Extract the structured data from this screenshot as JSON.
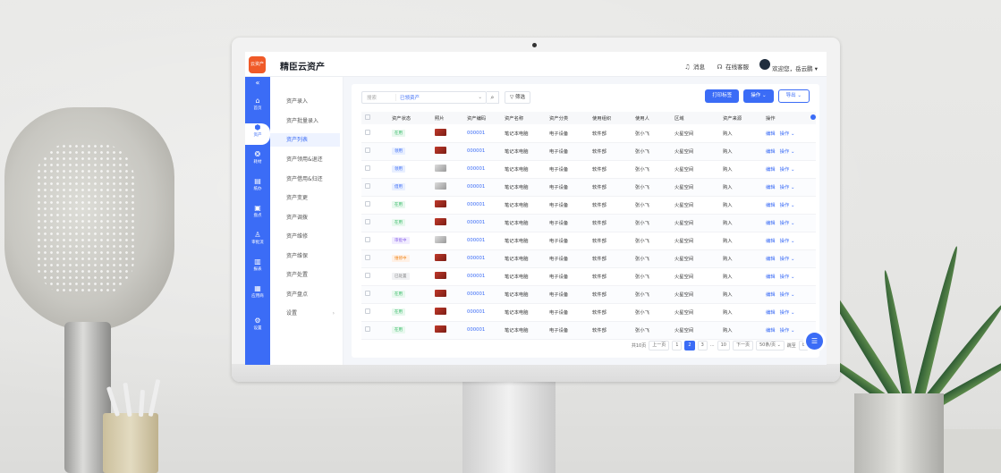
{
  "app": {
    "logo_text": "云资产",
    "title": "精臣云资产",
    "messages_label": "消息",
    "support_label": "在线客服",
    "welcome_text": "欢迎您，岳云鹏"
  },
  "rail": [
    {
      "icon": "«",
      "label": ""
    },
    {
      "icon": "⌂",
      "label": "首页"
    },
    {
      "icon": "⬢",
      "label": "资产"
    },
    {
      "icon": "❂",
      "label": "耗材"
    },
    {
      "icon": "▤",
      "label": "纸办"
    },
    {
      "icon": "▣",
      "label": "盘点"
    },
    {
      "icon": "♙",
      "label": "审批流"
    },
    {
      "icon": "▥",
      "label": "报表"
    },
    {
      "icon": "▦",
      "label": "应用商"
    },
    {
      "icon": "⚙",
      "label": "设置"
    }
  ],
  "submenu": [
    "资产录入",
    "资产批量录入",
    "资产列表",
    "资产领用&退还",
    "资产借用&归还",
    "资产变更",
    "资产调拨",
    "资产维修",
    "资产维保",
    "资产处置",
    "资产盘点",
    "设置"
  ],
  "filter": {
    "search_placeholder": "搜索",
    "select_value": "已领资产",
    "filter_label": "筛选"
  },
  "actions": {
    "print_label": "打印标签",
    "operate_label": "操作",
    "export_label": "导出"
  },
  "table": {
    "headers": [
      "资产状态",
      "照片",
      "资产编码",
      "资产名称",
      "资产分类",
      "使用组织",
      "使用人",
      "区域",
      "资产来源",
      "操作"
    ],
    "rows": [
      {
        "status": "在用",
        "status_color": "green",
        "photo": "red",
        "code": "000001",
        "name": "笔记本电脑",
        "category": "电子设备",
        "org": "软件部",
        "user": "张小飞",
        "area": "火星空间",
        "source": "购入",
        "edit": "编辑",
        "op": "操作"
      },
      {
        "status": "领用",
        "status_color": "blue",
        "photo": "red",
        "code": "000001",
        "name": "笔记本电脑",
        "category": "电子设备",
        "org": "软件部",
        "user": "张小飞",
        "area": "火星空间",
        "source": "购入",
        "edit": "编辑",
        "op": "操作"
      },
      {
        "status": "领用",
        "status_color": "blue",
        "photo": "gray",
        "code": "000001",
        "name": "笔记本电脑",
        "category": "电子设备",
        "org": "软件部",
        "user": "张小飞",
        "area": "火星空间",
        "source": "购入",
        "edit": "编辑",
        "op": "操作"
      },
      {
        "status": "借用",
        "status_color": "blue",
        "photo": "gray",
        "code": "000001",
        "name": "笔记本电脑",
        "category": "电子设备",
        "org": "软件部",
        "user": "张小飞",
        "area": "火星空间",
        "source": "购入",
        "edit": "编辑",
        "op": "操作"
      },
      {
        "status": "在用",
        "status_color": "green",
        "photo": "red",
        "code": "000001",
        "name": "笔记本电脑",
        "category": "电子设备",
        "org": "软件部",
        "user": "张小飞",
        "area": "火星空间",
        "source": "购入",
        "edit": "编辑",
        "op": "操作"
      },
      {
        "status": "在用",
        "status_color": "green",
        "photo": "red",
        "code": "000001",
        "name": "笔记本电脑",
        "category": "电子设备",
        "org": "软件部",
        "user": "张小飞",
        "area": "火星空间",
        "source": "购入",
        "edit": "编辑",
        "op": "操作"
      },
      {
        "status": "审批中",
        "status_color": "purple",
        "photo": "gray",
        "code": "000001",
        "name": "笔记本电脑",
        "category": "电子设备",
        "org": "软件部",
        "user": "张小飞",
        "area": "火星空间",
        "source": "购入",
        "edit": "编辑",
        "op": "操作"
      },
      {
        "status": "维修中",
        "status_color": "orange",
        "photo": "red",
        "code": "000001",
        "name": "笔记本电脑",
        "category": "电子设备",
        "org": "软件部",
        "user": "张小飞",
        "area": "火星空间",
        "source": "购入",
        "edit": "编辑",
        "op": "操作"
      },
      {
        "status": "已处置",
        "status_color": "gray",
        "photo": "red",
        "code": "000001",
        "name": "笔记本电脑",
        "category": "电子设备",
        "org": "软件部",
        "user": "张小飞",
        "area": "火星空间",
        "source": "购入",
        "edit": "编辑",
        "op": "操作"
      },
      {
        "status": "在用",
        "status_color": "green",
        "photo": "red",
        "code": "000001",
        "name": "笔记本电脑",
        "category": "电子设备",
        "org": "软件部",
        "user": "张小飞",
        "area": "火星空间",
        "source": "购入",
        "edit": "编辑",
        "op": "操作"
      },
      {
        "status": "在用",
        "status_color": "green",
        "photo": "red",
        "code": "000001",
        "name": "笔记本电脑",
        "category": "电子设备",
        "org": "软件部",
        "user": "张小飞",
        "area": "火星空间",
        "source": "购入",
        "edit": "编辑",
        "op": "操作"
      },
      {
        "status": "在用",
        "status_color": "green",
        "photo": "red",
        "code": "000001",
        "name": "笔记本电脑",
        "category": "电子设备",
        "org": "软件部",
        "user": "张小飞",
        "area": "火星空间",
        "source": "购入",
        "edit": "编辑",
        "op": "操作"
      }
    ]
  },
  "pagination": {
    "total": "共10页",
    "prev": "上一页",
    "pages": [
      "1",
      "2",
      "3",
      "···",
      "10"
    ],
    "next": "下一页",
    "page_size": "50条/页",
    "goto_label": "跳至",
    "goto_value": "8"
  },
  "colors": {
    "accent": "#3b6cf6",
    "logo": "#f05a28"
  }
}
